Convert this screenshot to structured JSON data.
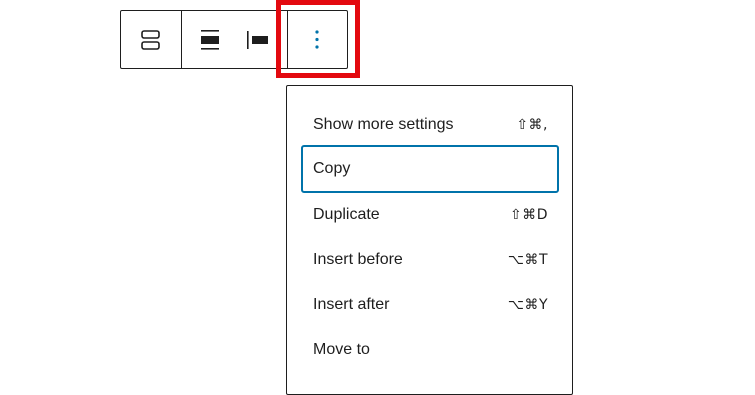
{
  "toolbar": {
    "buttons": [
      {
        "name": "block-type-icon"
      },
      {
        "name": "align-wide-icon"
      },
      {
        "name": "align-left-icon"
      },
      {
        "name": "more-options-icon"
      }
    ]
  },
  "menu": {
    "items": [
      {
        "label": "Show more settings",
        "shortcut": "⇧⌘,"
      },
      {
        "label": "Copy",
        "shortcut": ""
      },
      {
        "label": "Duplicate",
        "shortcut": "⇧⌘D"
      },
      {
        "label": "Insert before",
        "shortcut": "⌥⌘T"
      },
      {
        "label": "Insert after",
        "shortcut": "⌥⌘Y"
      },
      {
        "label": "Move to",
        "shortcut": ""
      }
    ]
  },
  "colors": {
    "accent": "#0073aa",
    "highlight": "#e3090f",
    "border": "#1e1e1e"
  }
}
